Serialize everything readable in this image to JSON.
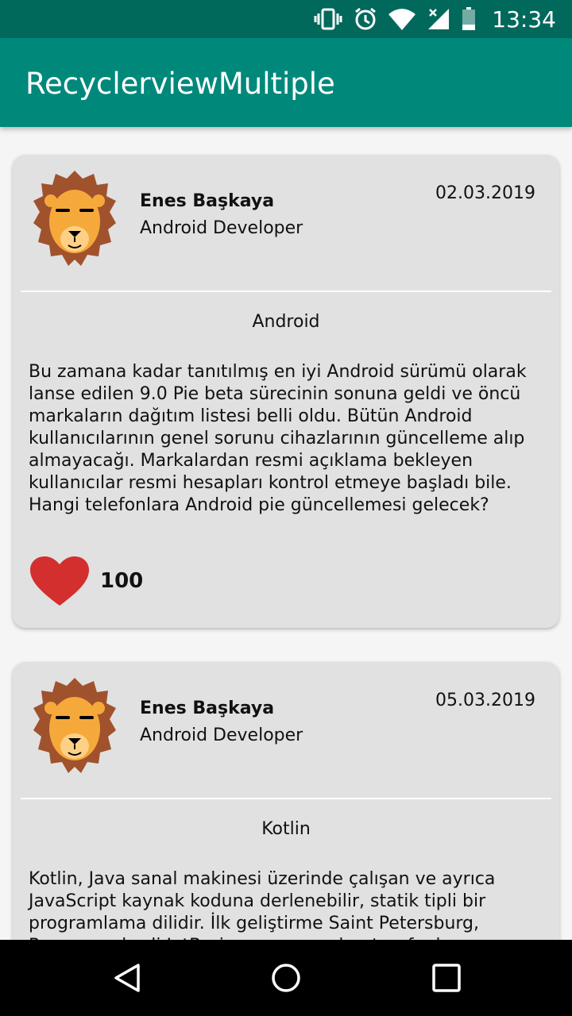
{
  "status_bar": {
    "time": "13:34",
    "icons": [
      "vibrate-icon",
      "alarm-icon",
      "wifi-icon",
      "signal-icon",
      "battery-icon"
    ]
  },
  "app_bar": {
    "title": "RecyclerviewMultiple"
  },
  "posts": [
    {
      "author": "Enes Başkaya",
      "role": "Android Developer",
      "date": "02.03.2019",
      "topic": "Android",
      "body": "Bu zamana kadar tanıtılmış en iyi Android sürümü olarak lanse edilen 9.0 Pie beta sürecinin sonuna geldi ve öncü markaların dağıtım listesi belli oldu. Bütün Android kullanıcılarının genel sorunu cihazlarının güncelleme alıp almayacağı. Markalardan resmi açıklama bekleyen kullanıcılar resmi hesapları kontrol etmeye başladı bile. Hangi telefonlara Android pie güncellemesi gelecek?",
      "likes": "100"
    },
    {
      "author": "Enes Başkaya",
      "role": "Android Developer",
      "date": "05.03.2019",
      "topic": "Kotlin",
      "body": "Kotlin, Java sanal makinesi üzerinde çalışan ve ayrıca JavaScript kaynak koduna derlenebilir, statik tipli bir programlama dilidir. İlk geliştirme Saint Petersburg, Rusya merkezli JetBrains programcıları tarafından yapılmıştır. İsmi"
    }
  ],
  "colors": {
    "primary": "#00897b",
    "primary_dark": "#00695c",
    "card": "#e1e1e1",
    "heart": "#d32f2f"
  }
}
